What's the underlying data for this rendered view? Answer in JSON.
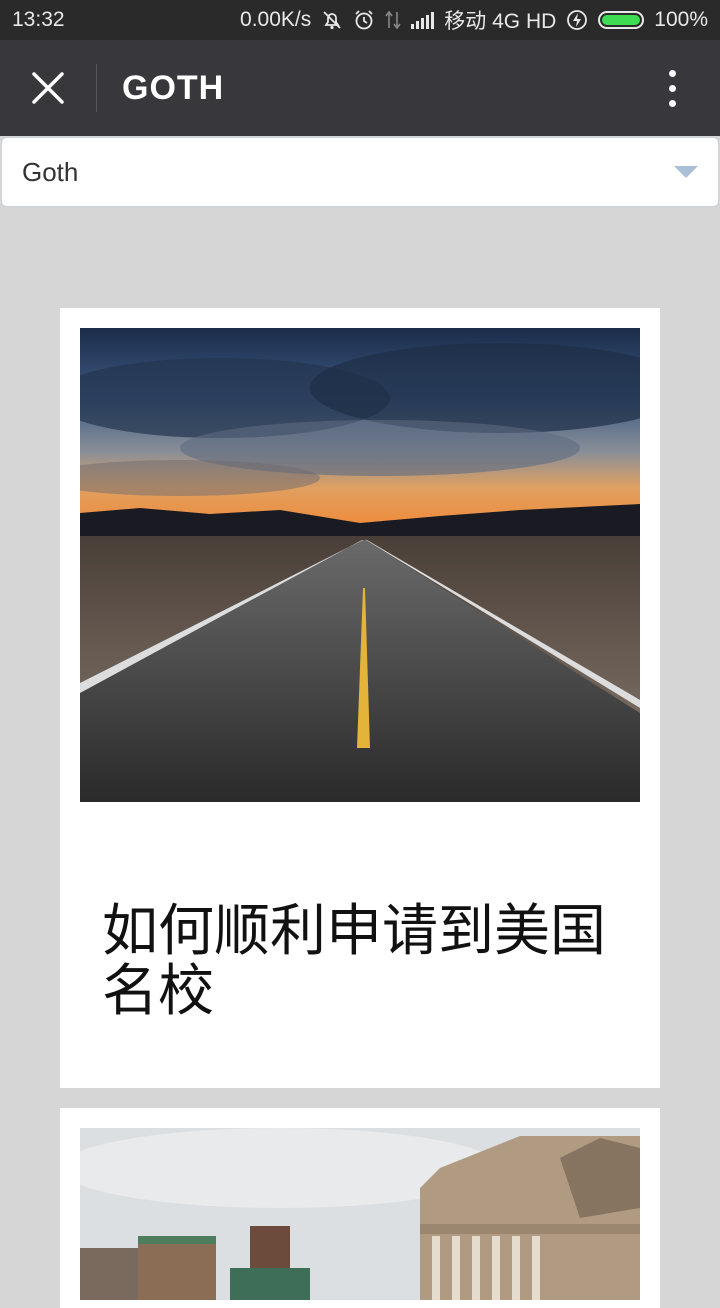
{
  "status_bar": {
    "time": "13:32",
    "net_speed": "0.00K/s",
    "carrier": "移动 4G HD",
    "battery_percent": "100%",
    "battery_level": 1.0,
    "icons": [
      "mute-icon",
      "alarm-icon",
      "data-arrows-icon",
      "signal-icon",
      "charging-icon",
      "battery-icon"
    ]
  },
  "header": {
    "title": "GOTH",
    "close_icon": "close-icon",
    "menu_icon": "more-vertical-icon"
  },
  "selector": {
    "value": "Goth",
    "icon": "dropdown-caret-icon"
  },
  "articles": [
    {
      "title": "如何顺利申请到美国名校",
      "image": "desert-road-photo"
    },
    {
      "title": "",
      "image": "campus-library-photo"
    }
  ],
  "colors": {
    "status_bar_bg": "#2a2a2a",
    "title_bar_bg": "#38373c",
    "page_bg": "#d6d6d6",
    "battery": "#3ddc52",
    "caret": "#a9c0d8"
  }
}
